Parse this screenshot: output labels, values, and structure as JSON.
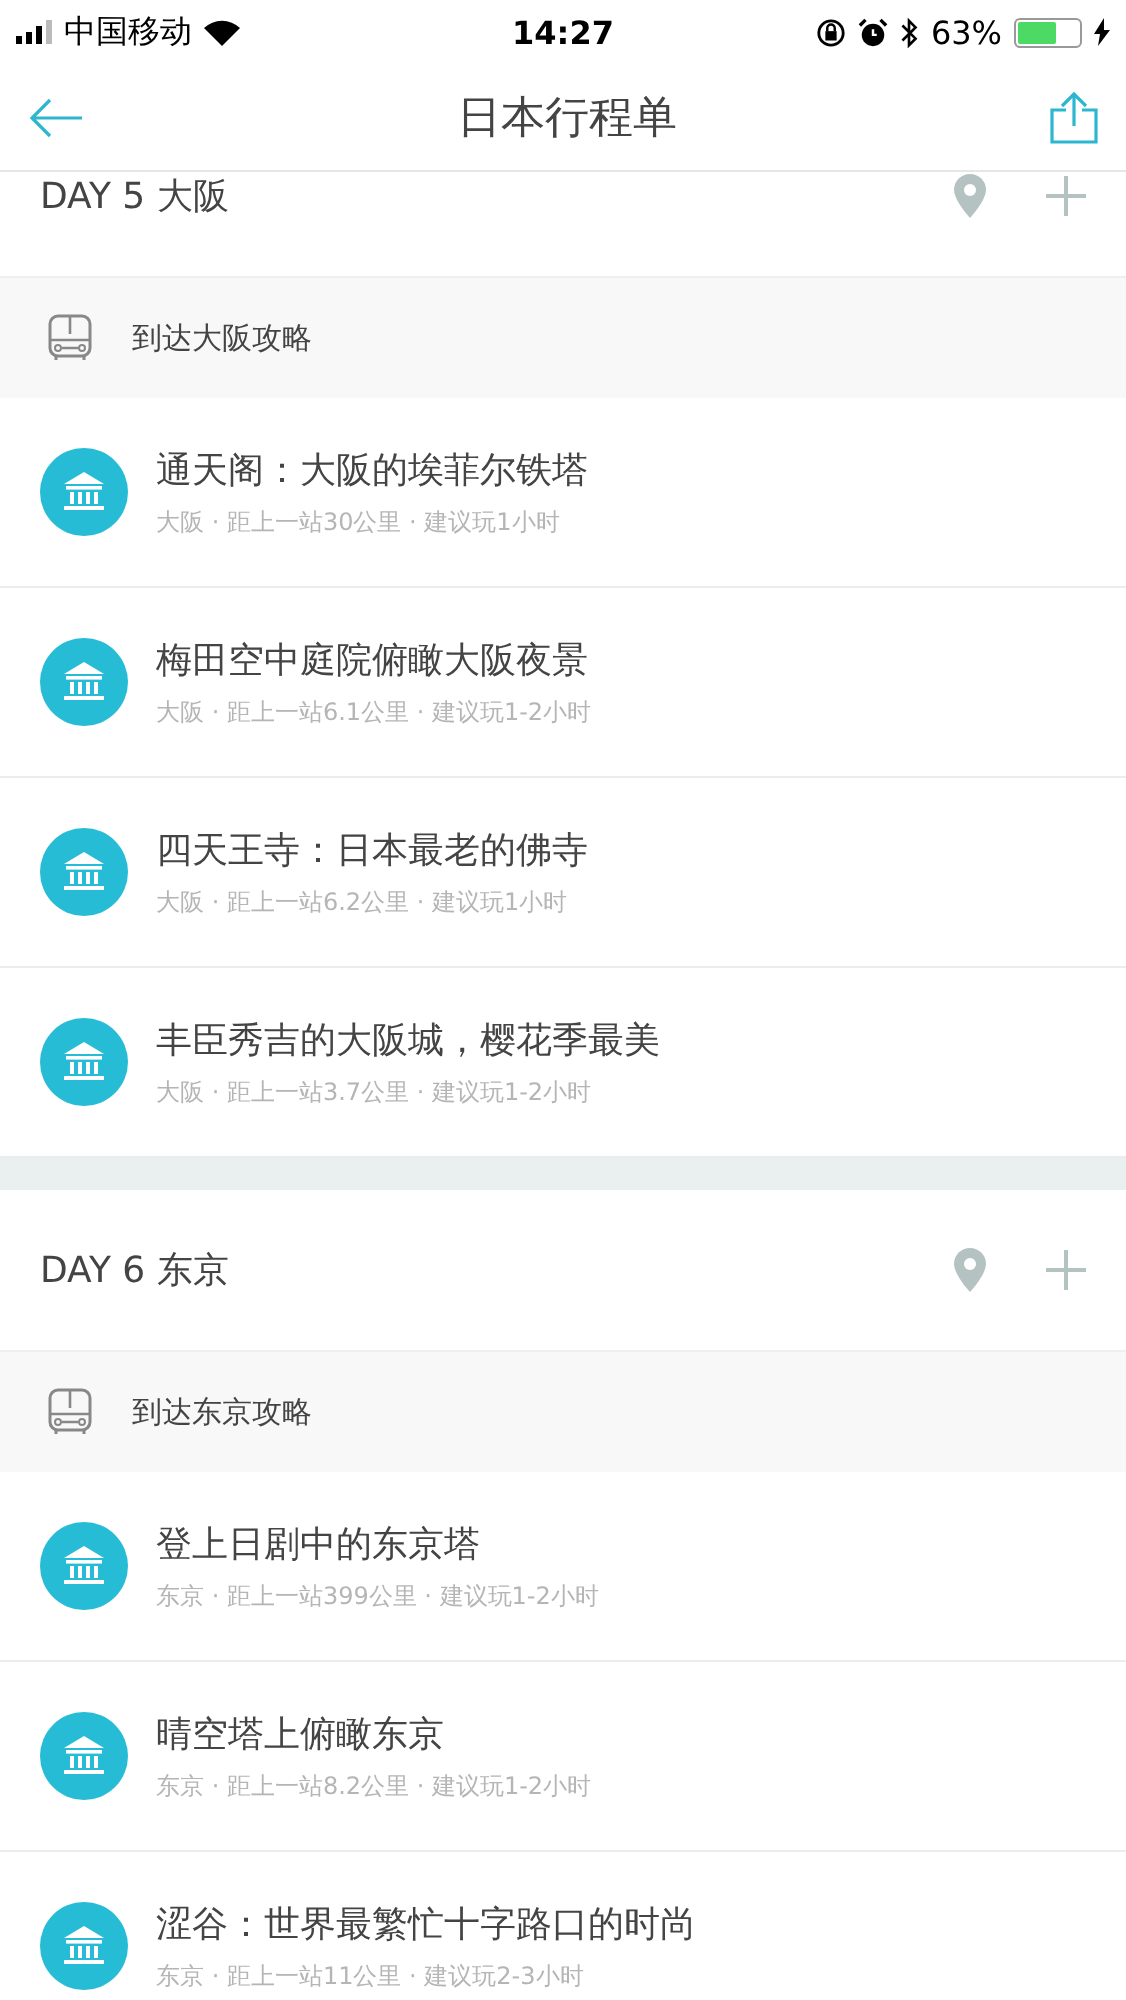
{
  "status_bar": {
    "carrier": "中国移动",
    "time": "14:27",
    "battery": "63%"
  },
  "nav": {
    "title": "日本行程单"
  },
  "days": [
    {
      "title": "DAY 5 大阪",
      "guide": "到达大阪攻略",
      "items": [
        {
          "name": "通天阁：大阪的埃菲尔铁塔",
          "meta": "大阪 · 距上一站30公里 · 建议玩1小时"
        },
        {
          "name": "梅田空中庭院俯瞰大阪夜景",
          "meta": "大阪 · 距上一站6.1公里 · 建议玩1-2小时"
        },
        {
          "name": "四天王寺：日本最老的佛寺",
          "meta": "大阪 · 距上一站6.2公里 · 建议玩1小时"
        },
        {
          "name": "丰臣秀吉的大阪城，樱花季最美",
          "meta": "大阪 · 距上一站3.7公里 · 建议玩1-2小时"
        }
      ]
    },
    {
      "title": "DAY 6 东京",
      "guide": "到达东京攻略",
      "items": [
        {
          "name": "登上日剧中的东京塔",
          "meta": "东京 · 距上一站399公里 · 建议玩1-2小时"
        },
        {
          "name": "晴空塔上俯瞰东京",
          "meta": "东京 · 距上一站8.2公里 · 建议玩1-2小时"
        },
        {
          "name": "涩谷：世界最繁忙十字路口的时尚",
          "meta": "东京 · 距上一站11公里 · 建议玩2-3小时"
        }
      ]
    }
  ]
}
